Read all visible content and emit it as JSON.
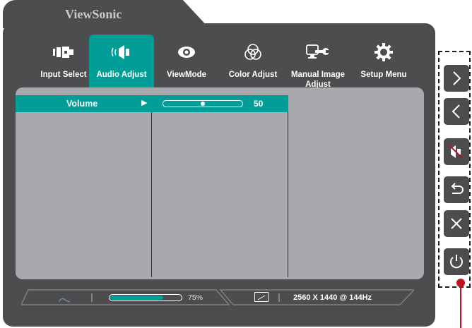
{
  "brand": "ViewSonic",
  "menu": {
    "items": [
      {
        "label": "Input Select",
        "icon": "input-select-icon"
      },
      {
        "label": "Audio Adjust",
        "icon": "speaker-icon",
        "active": true
      },
      {
        "label": "ViewMode",
        "icon": "eye-icon"
      },
      {
        "label": "Color Adjust",
        "icon": "color-circles-icon"
      },
      {
        "label": "Manual Image Adjust",
        "icon": "monitor-wrench-icon"
      },
      {
        "label": "Setup Menu",
        "icon": "gear-icon"
      }
    ]
  },
  "submenu": {
    "volume_label": "Volume",
    "volume_value": "50",
    "volume_level": 50
  },
  "status_bar": {
    "brightness_percent": "75%",
    "brightness_level": 75,
    "resolution": "2560 X 1440 @ 144Hz"
  },
  "side_buttons": [
    "chevron-right-icon",
    "chevron-left-icon",
    "mute-icon",
    "return-icon",
    "close-icon",
    "power-icon"
  ],
  "colors": {
    "panel": "#4d4d4f",
    "accent": "#009e96",
    "content": "#a7a9ac",
    "frame": "#1a1a1a",
    "pointer": "#c1121f"
  }
}
